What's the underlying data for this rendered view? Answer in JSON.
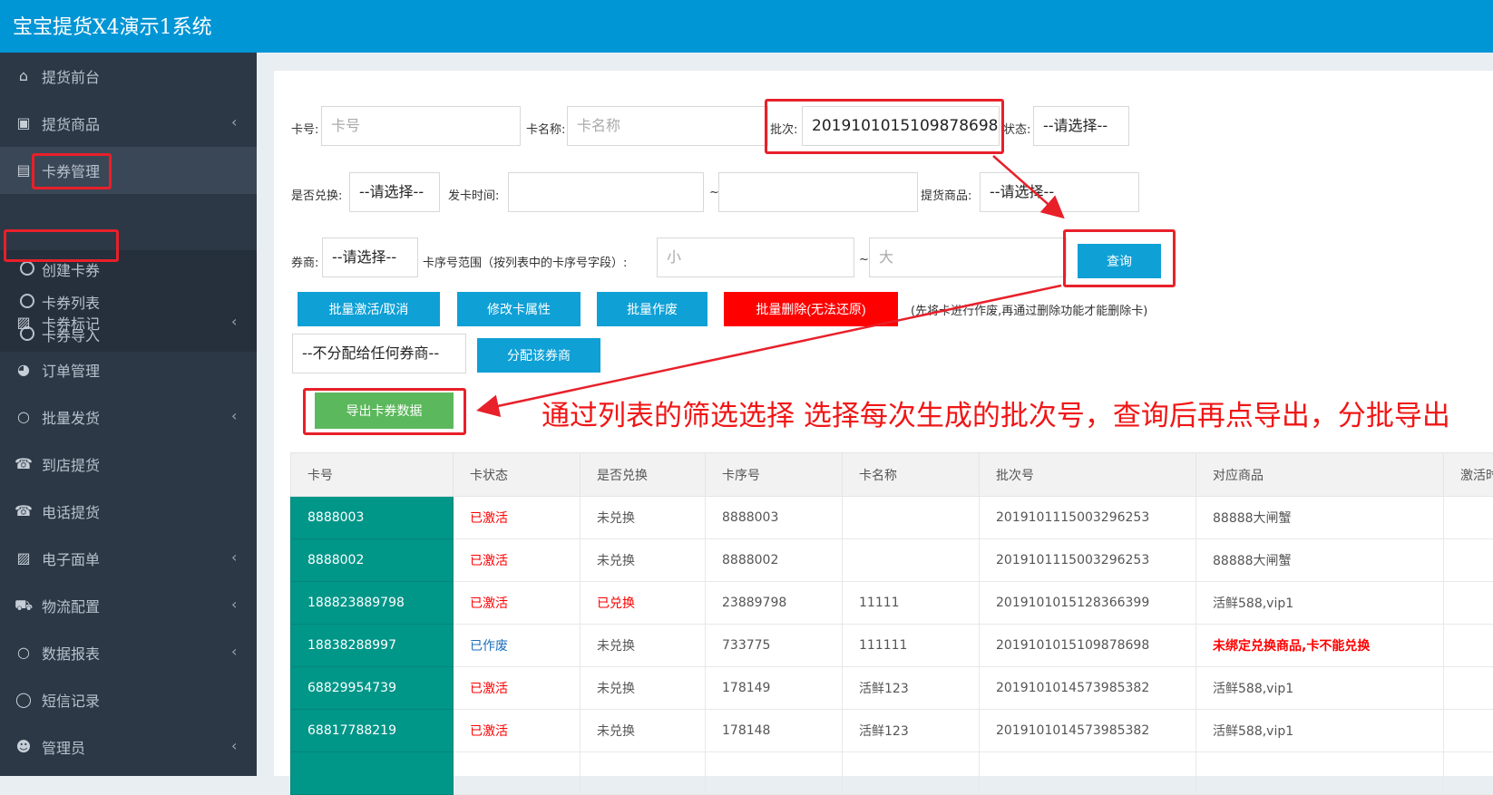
{
  "app": {
    "title": "宝宝提货X4演示1系统"
  },
  "sidebar": {
    "items": [
      {
        "label": "提货前台",
        "icon": "home-icon",
        "chevron": ""
      },
      {
        "label": "提货商品",
        "icon": "inbox-icon",
        "chevron": "‹"
      },
      {
        "label": "卡券管理",
        "icon": "id-card-icon",
        "chevron": ""
      },
      {
        "label": "卡券标记",
        "icon": "briefcase-icon",
        "chevron": "‹"
      },
      {
        "label": "订单管理",
        "icon": "pie-chart-icon",
        "chevron": ""
      },
      {
        "label": "批量发货",
        "icon": "circle-icon",
        "chevron": "‹"
      },
      {
        "label": "到店提货",
        "icon": "phone-icon",
        "chevron": ""
      },
      {
        "label": "电话提货",
        "icon": "phone-icon",
        "chevron": ""
      },
      {
        "label": "电子面单",
        "icon": "briefcase-icon",
        "chevron": "‹"
      },
      {
        "label": "物流配置",
        "icon": "truck-icon",
        "chevron": "‹"
      },
      {
        "label": "数据报表",
        "icon": "circle-icon",
        "chevron": "‹"
      },
      {
        "label": "短信记录",
        "icon": "comment-icon",
        "chevron": ""
      },
      {
        "label": "管理员",
        "icon": "users-icon",
        "chevron": "‹"
      }
    ],
    "subitems": [
      {
        "label": "创建卡券"
      },
      {
        "label": "卡券列表"
      },
      {
        "label": "卡券导入"
      }
    ]
  },
  "filters": {
    "card_no": {
      "label": "卡号:",
      "placeholder": "卡号"
    },
    "card_name": {
      "label": "卡名称:",
      "placeholder": "卡名称"
    },
    "batch": {
      "label": "批次:",
      "value": "2019101015109878698"
    },
    "status": {
      "label": "状态:",
      "value": "--请选择--"
    },
    "exchanged": {
      "label": "是否兑换:",
      "value": "--请选择--"
    },
    "issue_time": {
      "label": "发卡时间:",
      "separator": "~"
    },
    "goods": {
      "label": "提货商品:",
      "value": "--请选择--"
    },
    "dealer": {
      "label": "券商:",
      "value": "--请选择--"
    },
    "range": {
      "label": "卡序号范围（按列表中的卡序号字段）:",
      "min_placeholder": "小",
      "max_placeholder": "大",
      "separator": "~"
    },
    "query_button": "查询"
  },
  "actions": {
    "batch_activate": "批量激活/取消",
    "modify_attr": "修改卡属性",
    "batch_void": "批量作废",
    "batch_delete": "批量删除(无法还原)",
    "delete_note": "(先将卡进行作废,再通过删除功能才能删除卡)",
    "dealer_select": "--不分配给任何券商--",
    "assign_dealer": "分配该券商",
    "export": "导出卡券数据"
  },
  "annotation": "通过列表的筛选选择   选择每次生成的批次号，查询后再点导出，分批导出",
  "table": {
    "headers": [
      "卡号",
      "卡状态",
      "是否兑换",
      "卡序号",
      "卡名称",
      "批次号",
      "对应商品",
      "激活时间"
    ],
    "rows": [
      [
        "8888003",
        "已激活",
        "未兑换",
        "8888003",
        "",
        "2019101115003296253",
        "88888大闸蟹"
      ],
      [
        "8888002",
        "已激活",
        "未兑换",
        "8888002",
        "",
        "2019101115003296253",
        "88888大闸蟹"
      ],
      [
        "188823889798",
        "已激活",
        "已兑换",
        "23889798",
        "11111",
        "2019101015128366399",
        "活鲜588,vip1"
      ],
      [
        "18838288997",
        "已作废",
        "未兑换",
        "733775",
        "111111",
        "2019101015109878698",
        "未绑定兑换商品,卡不能兑换"
      ],
      [
        "68829954739",
        "已激活",
        "未兑换",
        "178149",
        "活鲜123",
        "2019101014573985382",
        "活鲜588,vip1"
      ],
      [
        "68817788219",
        "已激活",
        "未兑换",
        "178148",
        "活鲜123",
        "2019101014573985382",
        "活鲜588,vip1"
      ],
      [
        "",
        "",
        "",
        "",
        "",
        "",
        ""
      ]
    ]
  },
  "colors": {
    "topbar": "#0095d5",
    "sidebar": "#2c3846",
    "button_blue": "#0fa0d6",
    "button_red": "#ff0000",
    "button_green": "#5cb85c",
    "first_column": "#009688",
    "annotation": "#f01616"
  }
}
